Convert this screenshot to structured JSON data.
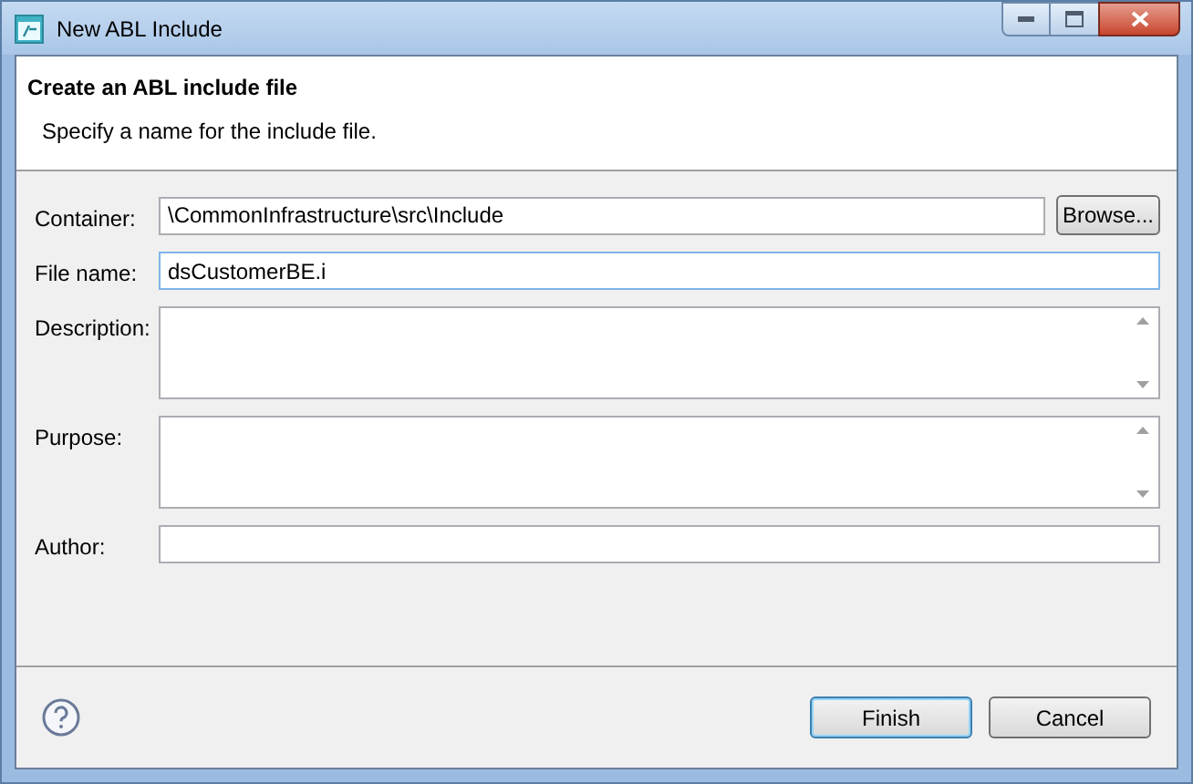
{
  "window": {
    "title": "New ABL Include"
  },
  "header": {
    "title": "Create an ABL include file",
    "message": "Specify a name for the include file."
  },
  "fields": [
    {
      "kind": "text",
      "label": "Container:",
      "value": "\\CommonInfrastructure\\src\\Include",
      "focused": false,
      "button": "Browse..."
    },
    {
      "kind": "text",
      "label": "File name:",
      "value": "dsCustomerBE.i",
      "focused": true
    },
    {
      "kind": "textarea",
      "label": "Description:",
      "focused": false
    },
    {
      "kind": "textarea",
      "label": "Purpose:",
      "focused": false
    },
    {
      "kind": "text",
      "label": "Author:",
      "focused": false
    }
  ],
  "buttons": [
    {
      "label": "Finish",
      "default": true
    },
    {
      "label": "Cancel",
      "default": false
    }
  ]
}
